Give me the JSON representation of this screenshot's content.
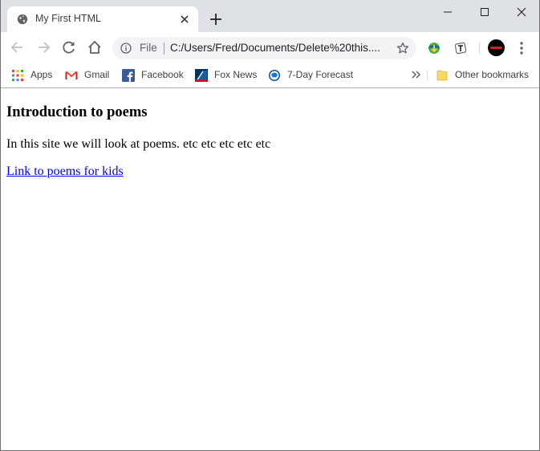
{
  "tab": {
    "title": "My First HTML",
    "favicon": "globe-icon"
  },
  "window_controls": [
    "minimize-icon",
    "maximize-icon",
    "close-icon"
  ],
  "omnibox": {
    "scheme": "File",
    "url": "C:/Users/Fred/Documents/Delete%20this...."
  },
  "bookmarks": [
    {
      "label": "Apps",
      "icon": "apps-grid-icon"
    },
    {
      "label": "Gmail",
      "icon": "gmail-icon"
    },
    {
      "label": "Facebook",
      "icon": "facebook-icon"
    },
    {
      "label": "Fox News",
      "icon": "fox-news-icon"
    },
    {
      "label": "7-Day Forecast",
      "icon": "noaa-icon"
    }
  ],
  "other_bookmarks": {
    "label": "Other bookmarks",
    "icon": "folder-icon"
  },
  "page": {
    "heading": "Introduction to poems",
    "paragraph": "In this site we will look at poems. etc etc etc etc etc",
    "link_text": "Link to poems for kids"
  },
  "colors": {
    "link": "#0000ee",
    "tab_strip": "#dee1e6",
    "omnibox_bg": "#f1f3f4"
  }
}
